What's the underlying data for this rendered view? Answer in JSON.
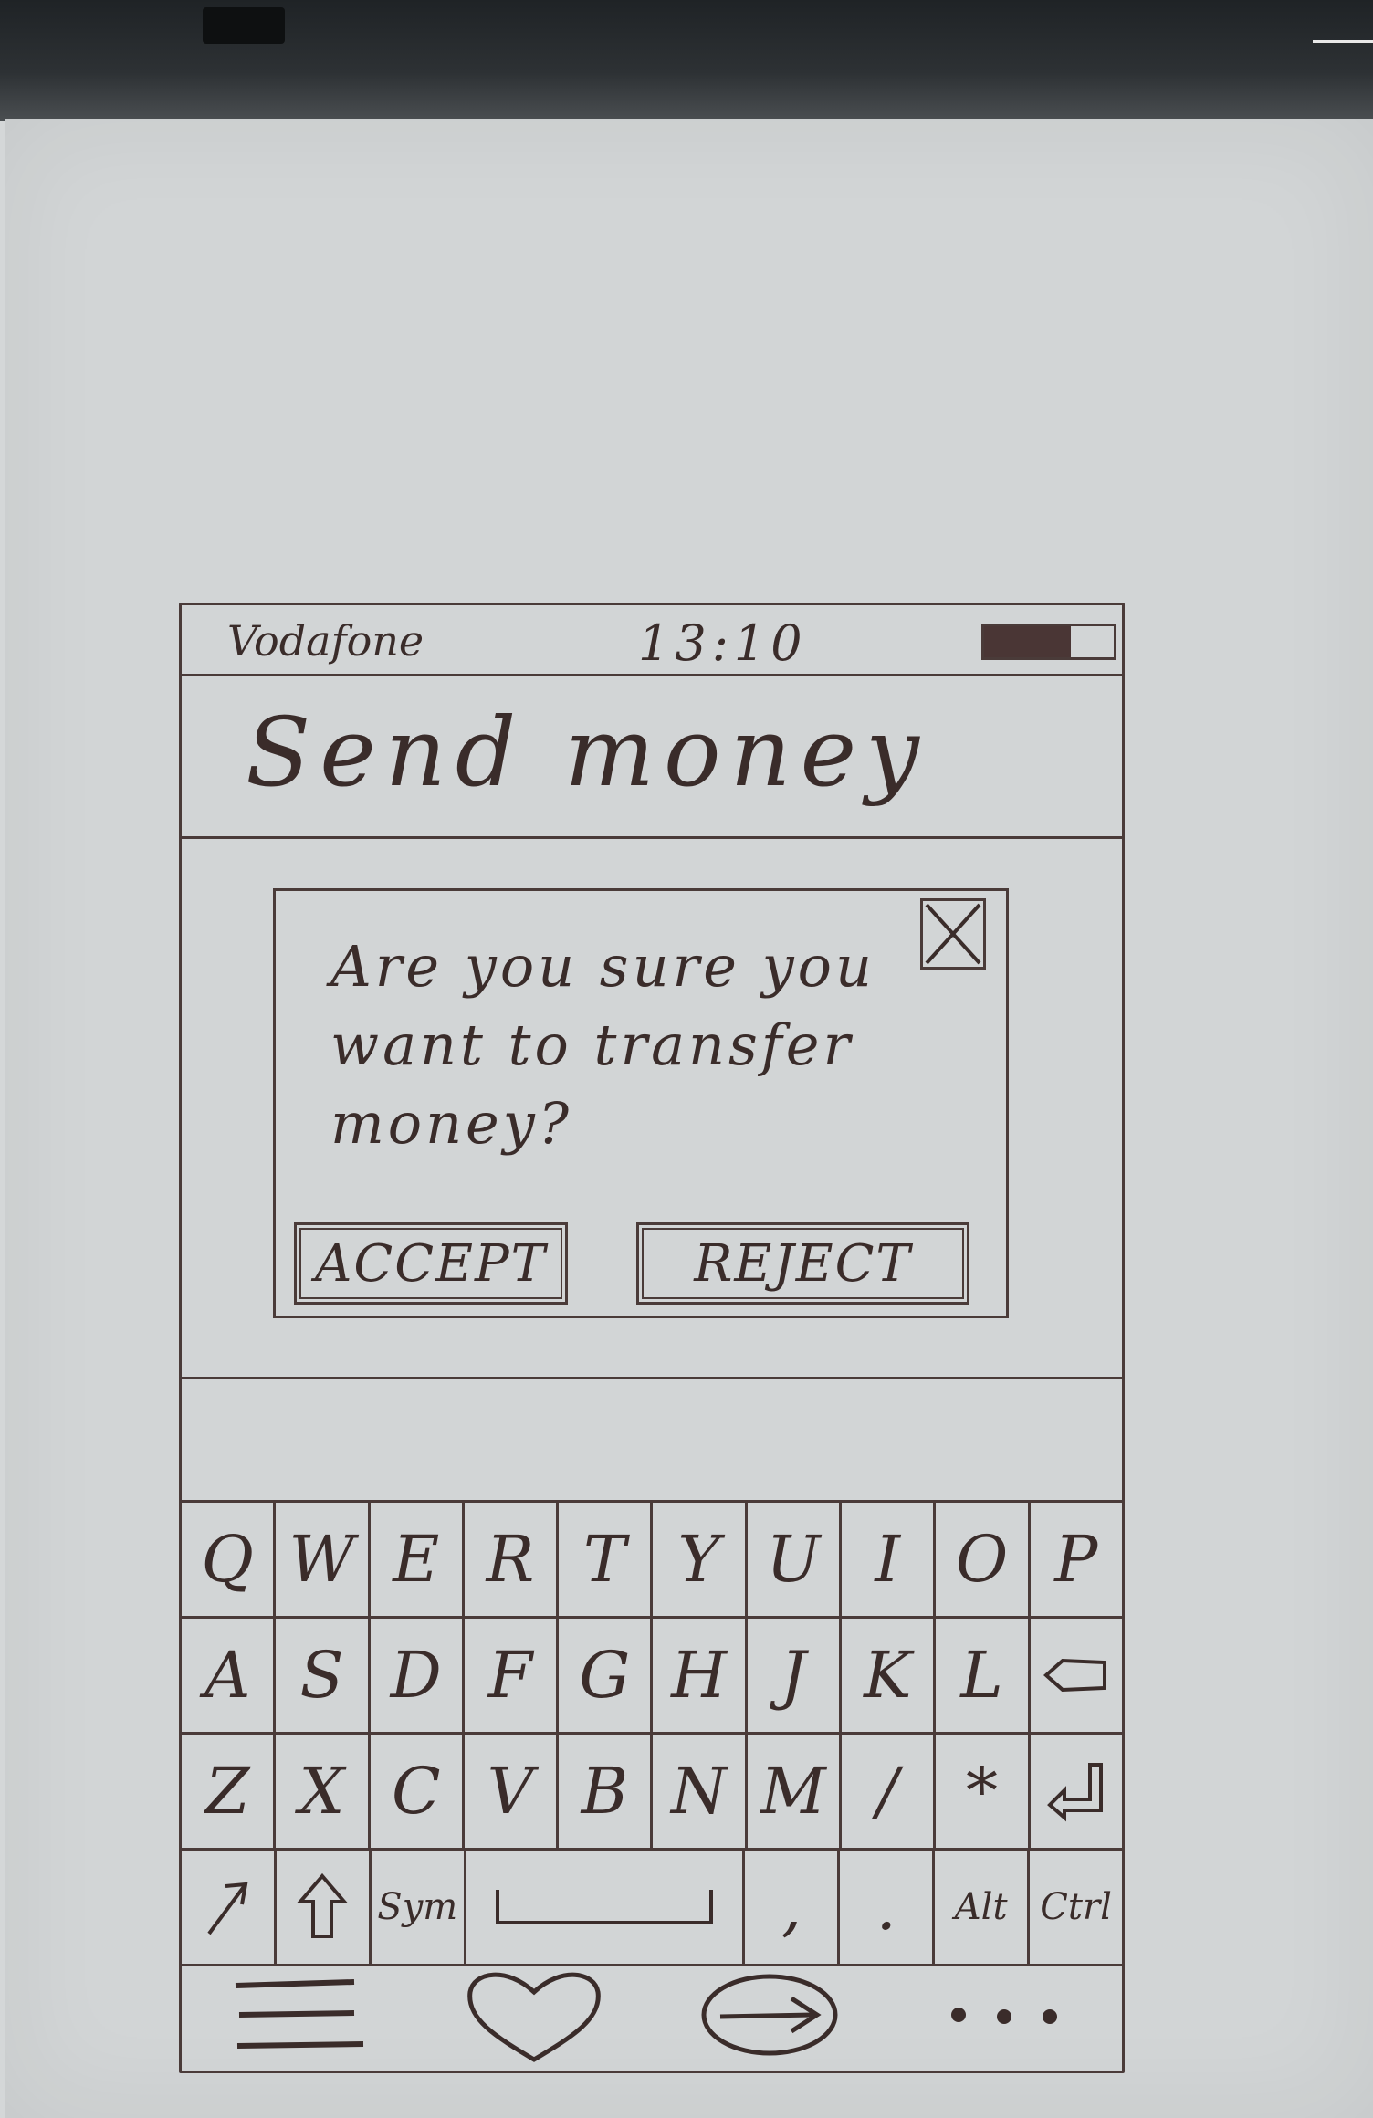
{
  "status_bar": {
    "carrier": "Vodafone",
    "time": "13:10"
  },
  "header": {
    "title": "Send money"
  },
  "dialog": {
    "message": "Are you sure you want to transfer money?",
    "accept_label": "ACCEPT",
    "reject_label": "REJECT"
  },
  "keyboard": {
    "row1": [
      "Q",
      "W",
      "E",
      "R",
      "T",
      "Y",
      "U",
      "I",
      "O",
      "P"
    ],
    "row2": [
      "A",
      "S",
      "D",
      "F",
      "G",
      "H",
      "J",
      "K",
      "L"
    ],
    "row3": [
      "Z",
      "X",
      "C",
      "V",
      "B",
      "N",
      "M",
      "/",
      "*"
    ],
    "row4": {
      "sym": "Sym",
      "comma": ",",
      "period": ".",
      "alt": "Alt",
      "ctrl": "Ctrl"
    }
  },
  "icons": {
    "battery": "battery-icon",
    "close": "close-icon",
    "backspace": "backspace-icon",
    "enter": "enter-icon",
    "arrow": "diagonal-arrow-icon",
    "shift": "shift-icon",
    "menu": "menu-icon",
    "favorite": "heart-icon",
    "send": "send-arrow-icon",
    "more": "more-icon"
  },
  "colors": {
    "ink": "#3a2c2a",
    "paper": "#d2d5d6"
  }
}
